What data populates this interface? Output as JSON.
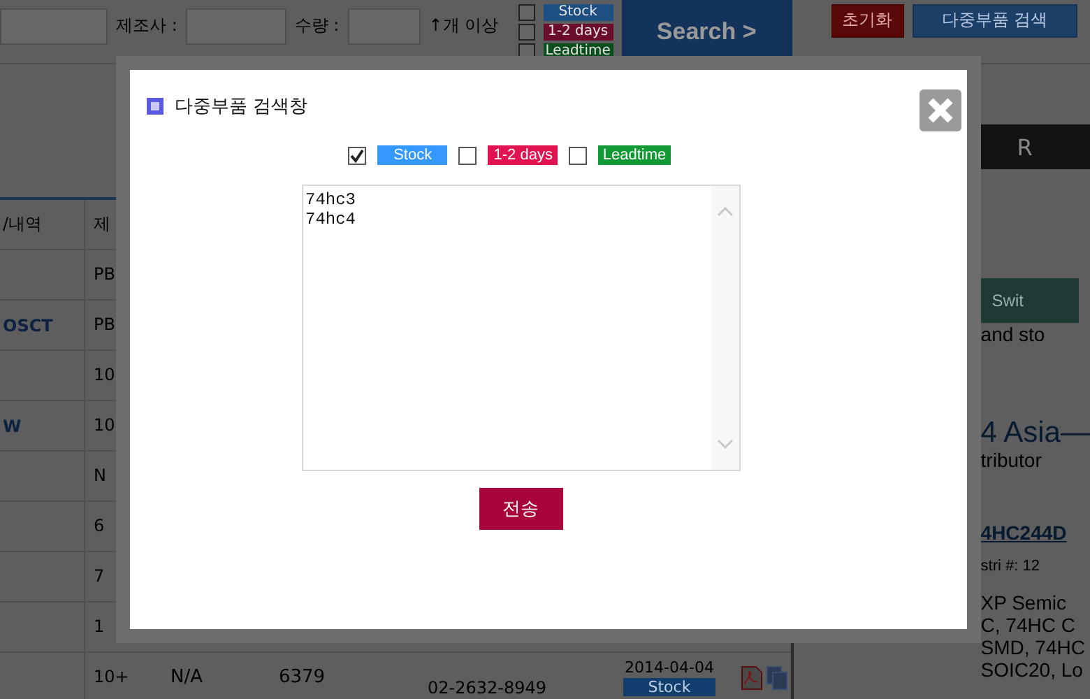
{
  "filter_bar": {
    "manufacturer_label": "제조사 :",
    "quantity_label": "수량 :",
    "quantity_suffix": "↑개 이상",
    "availability": [
      {
        "label": "Stock",
        "checked": false,
        "color": "#1d4f82"
      },
      {
        "label": "1-2 days",
        "checked": false,
        "color": "#6a0d2c"
      },
      {
        "label": "Leadtime",
        "checked": false,
        "color": "#0c4f1f"
      }
    ],
    "search_button": "Search  >",
    "reset_button": "초기화",
    "multi_search_button": "다중부품 검색"
  },
  "table": {
    "columns": [
      "/내역",
      "제"
    ],
    "rows": [
      {
        "cells": [
          "",
          "PB"
        ]
      },
      {
        "cells": [
          "OSCT",
          "PB"
        ]
      },
      {
        "cells": [
          "",
          "10"
        ]
      },
      {
        "cells": [
          "W",
          "10"
        ]
      },
      {
        "cells": [
          "",
          "N"
        ]
      },
      {
        "cells": [
          "",
          "6"
        ]
      },
      {
        "cells": [
          "",
          "7"
        ]
      },
      {
        "cells": [
          "",
          "1"
        ]
      },
      {
        "cells": [
          "",
          "10+",
          "N/A",
          "6379"
        ],
        "phone": "02-2632-8949",
        "date": "2014-04-04",
        "badge": "Stock"
      }
    ]
  },
  "right_panel": {
    "header": "R",
    "switch_button": "Swit",
    "texts": [
      {
        "kind": "plain",
        "text": "and sto"
      },
      {
        "kind": "big",
        "text": "4 Asia—"
      },
      {
        "kind": "plain",
        "text": "tributor"
      },
      {
        "kind": "link",
        "text": "4HC244D"
      },
      {
        "kind": "small",
        "text": "stri #: 12"
      },
      {
        "kind": "plain",
        "text": "XP Semic"
      },
      {
        "kind": "plain",
        "text": "C, 74HC C"
      },
      {
        "kind": "plain",
        "text": "SMD, 74HC"
      },
      {
        "kind": "plain",
        "text": "SOIC20, Lo"
      }
    ]
  },
  "modal": {
    "title": "다중부품 검색창",
    "options": [
      {
        "label": "Stock",
        "checked": true,
        "color": "#3399ff"
      },
      {
        "label": "1-2 days",
        "checked": false,
        "color": "#e0124f"
      },
      {
        "label": "Leadtime",
        "checked": false,
        "color": "#119933"
      }
    ],
    "textarea": {
      "value": "74hc3\n74hc4"
    },
    "submit_button": "전송"
  }
}
